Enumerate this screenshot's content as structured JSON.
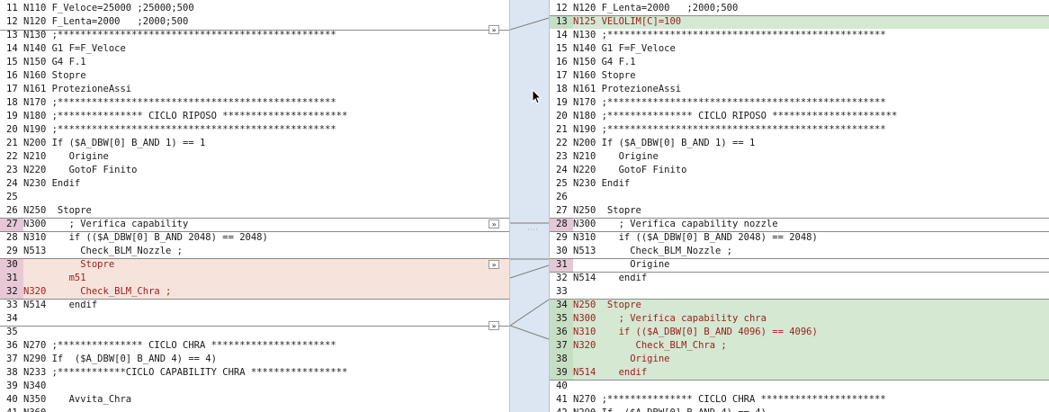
{
  "left": {
    "lines": [
      {
        "n": "11",
        "code": "N110 F_Veloce=25000 ;25000;500",
        "style": ""
      },
      {
        "n": "12",
        "code": "N120 F_Lenta=2000   ;2000;500",
        "style": ""
      },
      {
        "n": "13",
        "code": "N130 ;*************************************************",
        "style": ""
      },
      {
        "n": "14",
        "code": "N140 G1 F=F_Veloce",
        "style": ""
      },
      {
        "n": "15",
        "code": "N150 G4 F.1",
        "style": ""
      },
      {
        "n": "16",
        "code": "N160 Stopre",
        "style": ""
      },
      {
        "n": "17",
        "code": "N161 ProtezioneAssi",
        "style": ""
      },
      {
        "n": "18",
        "code": "N170 ;*************************************************",
        "style": ""
      },
      {
        "n": "19",
        "code": "N180 ;*************** CICLO RIPOSO **********************",
        "style": ""
      },
      {
        "n": "20",
        "code": "N190 ;*************************************************",
        "style": ""
      },
      {
        "n": "21",
        "code": "N200 If ($A_DBW[0] B_AND 1) == 1",
        "style": ""
      },
      {
        "n": "22",
        "code": "N210    Origine",
        "style": ""
      },
      {
        "n": "23",
        "code": "N220    GotoF Finito",
        "style": ""
      },
      {
        "n": "24",
        "code": "N230 Endif",
        "style": ""
      },
      {
        "n": "25",
        "code": "",
        "style": ""
      },
      {
        "n": "26",
        "code": "N250  Stopre",
        "style": ""
      },
      {
        "n": "27",
        "code": "N300    ; Verifica capability",
        "style": "mod"
      },
      {
        "n": "28",
        "code": "N310    if (($A_DBW[0] B_AND 2048) == 2048)",
        "style": ""
      },
      {
        "n": "29",
        "code": "N513      Check_BLM_Nozzle ;",
        "style": ""
      },
      {
        "n": "30",
        "code": "          Stopre",
        "style": "del"
      },
      {
        "n": "31",
        "code": "        m51",
        "style": "del"
      },
      {
        "n": "32",
        "code": "N320      Check_BLM_Chra ;",
        "style": "del"
      },
      {
        "n": "33",
        "code": "N514    endif",
        "style": ""
      },
      {
        "n": "34",
        "code": "",
        "style": ""
      },
      {
        "n": "35",
        "code": "",
        "style": ""
      },
      {
        "n": "36",
        "code": "N270 ;*************** CICLO CHRA **********************",
        "style": ""
      },
      {
        "n": "37",
        "code": "N290 If  ($A_DBW[0] B_AND 4) == 4)",
        "style": ""
      },
      {
        "n": "38",
        "code": "N233 ;************CICLO CAPABILITY CHRA *****************",
        "style": ""
      },
      {
        "n": "39",
        "code": "N340",
        "style": ""
      },
      {
        "n": "40",
        "code": "N350    Avvita_Chra",
        "style": ""
      },
      {
        "n": "41",
        "code": "N360",
        "style": ""
      }
    ]
  },
  "right": {
    "lines": [
      {
        "n": "12",
        "code": "N120 F_Lenta=2000   ;2000;500",
        "style": ""
      },
      {
        "n": "13",
        "code": "N125 VELOLIM[C]=100",
        "style": "add"
      },
      {
        "n": "14",
        "code": "N130 ;*************************************************",
        "style": ""
      },
      {
        "n": "15",
        "code": "N140 G1 F=F_Veloce",
        "style": ""
      },
      {
        "n": "16",
        "code": "N150 G4 F.1",
        "style": ""
      },
      {
        "n": "17",
        "code": "N160 Stopre",
        "style": ""
      },
      {
        "n": "18",
        "code": "N161 ProtezioneAssi",
        "style": ""
      },
      {
        "n": "19",
        "code": "N170 ;*************************************************",
        "style": ""
      },
      {
        "n": "20",
        "code": "N180 ;*************** CICLO RIPOSO **********************",
        "style": ""
      },
      {
        "n": "21",
        "code": "N190 ;*************************************************",
        "style": ""
      },
      {
        "n": "22",
        "code": "N200 If ($A_DBW[0] B_AND 1) == 1",
        "style": ""
      },
      {
        "n": "23",
        "code": "N210    Origine",
        "style": ""
      },
      {
        "n": "24",
        "code": "N220    GotoF Finito",
        "style": ""
      },
      {
        "n": "25",
        "code": "N230 Endif",
        "style": ""
      },
      {
        "n": "26",
        "code": "",
        "style": ""
      },
      {
        "n": "27",
        "code": "N250  Stopre",
        "style": ""
      },
      {
        "n": "28",
        "code": "N300    ; Verifica capability nozzle",
        "style": "mod"
      },
      {
        "n": "29",
        "code": "N310    if (($A_DBW[0] B_AND 2048) == 2048)",
        "style": ""
      },
      {
        "n": "30",
        "code": "N513      Check_BLM_Nozzle ;",
        "style": ""
      },
      {
        "n": "31",
        "code": "          Origine",
        "style": "mod"
      },
      {
        "n": "32",
        "code": "N514    endif",
        "style": ""
      },
      {
        "n": "33",
        "code": "",
        "style": ""
      },
      {
        "n": "34",
        "code": "N250  Stopre",
        "style": "add"
      },
      {
        "n": "35",
        "code": "N300    ; Verifica capability chra",
        "style": "add"
      },
      {
        "n": "36",
        "code": "N310    if (($A_DBW[0] B_AND 4096) == 4096)",
        "style": "add"
      },
      {
        "n": "37",
        "code": "N320       Check_BLM_Chra ;",
        "style": "add"
      },
      {
        "n": "38",
        "code": "          Origine",
        "style": "add"
      },
      {
        "n": "39",
        "code": "N514    endif",
        "style": "add"
      },
      {
        "n": "40",
        "code": "",
        "style": ""
      },
      {
        "n": "41",
        "code": "N270 ;*************** CICLO CHRA **********************",
        "style": ""
      },
      {
        "n": "42",
        "code": "N290 If  ($A_DBW[0] B_AND 4) == 4)",
        "style": ""
      }
    ]
  },
  "icons": {
    "copy_arrow": "»",
    "cursor": "mouse-pointer-icon"
  },
  "colors": {
    "deleted": "#f6e4dc",
    "added": "#d4e8d2",
    "gutter": "#dce6f2"
  }
}
